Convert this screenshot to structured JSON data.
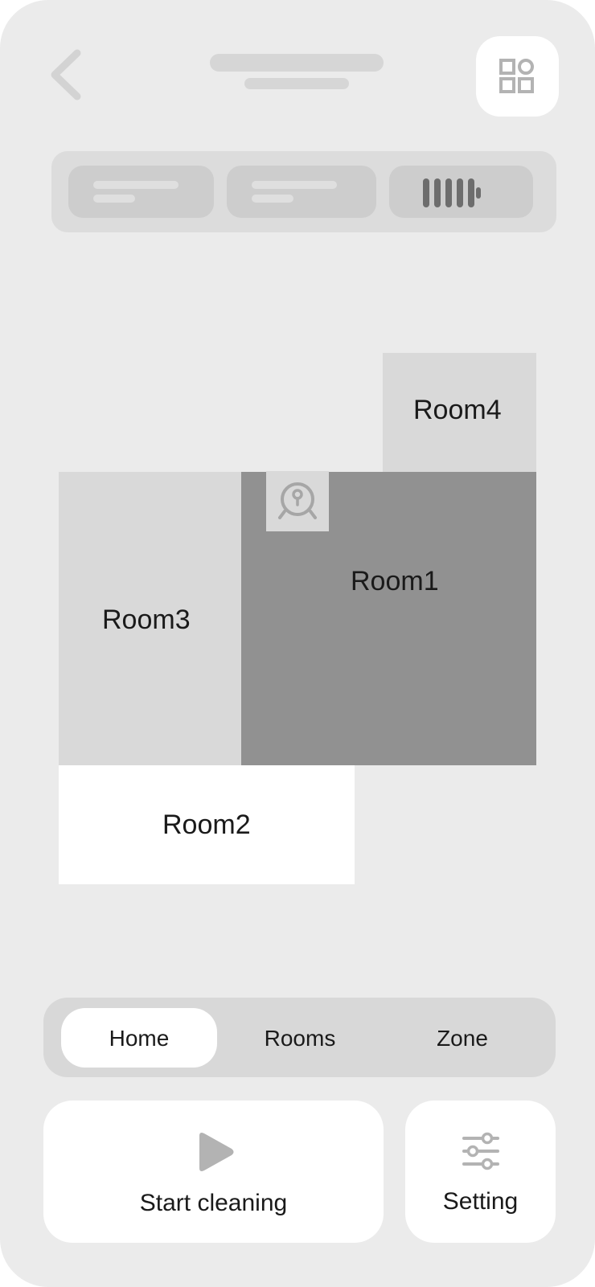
{
  "header": {
    "back_icon": "chevron-left-icon",
    "menu_icon": "grid-icon"
  },
  "status": {
    "battery_icon": "battery-icon"
  },
  "map": {
    "robot_icon": "robot-vacuum-icon",
    "rooms": [
      {
        "id": "room4",
        "label": "Room4",
        "fill": "#d9d9d9"
      },
      {
        "id": "room3",
        "label": "Room3",
        "fill": "#d9d9d9"
      },
      {
        "id": "room1",
        "label": "Room1",
        "fill": "#919191",
        "selected": true
      },
      {
        "id": "room2",
        "label": "Room2",
        "fill": "#ffffff"
      }
    ]
  },
  "mode_tabs": {
    "selected": "Home",
    "items": [
      {
        "label": "Home"
      },
      {
        "label": "Rooms"
      },
      {
        "label": "Zone"
      }
    ]
  },
  "actions": {
    "start": {
      "label": "Start cleaning",
      "icon": "play-icon"
    },
    "setting": {
      "label": "Setting",
      "icon": "sliders-icon"
    }
  },
  "colors": {
    "background": "#ebebeb",
    "selected_room": "#919191",
    "icon_gray": "#b3b3b3"
  }
}
